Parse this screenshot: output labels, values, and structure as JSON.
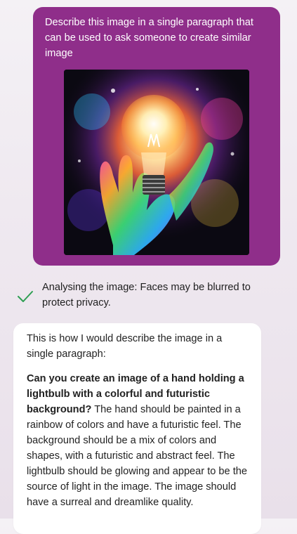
{
  "user_message": {
    "text": "Describe this image in a single paragraph that can be used to ask someone to create similar image",
    "image_alt": "Painted hand holding a glowing lightbulb against a colorful cosmic background",
    "bubble_color": "#8f2e8a"
  },
  "status": {
    "icon": "checkmark-icon",
    "icon_color": "#2e9e52",
    "text": "Analysing the image: Faces may be blurred to protect privacy."
  },
  "bot_message": {
    "intro": "This is how I would describe the image in a single paragraph:",
    "bold_lead": "Can you create an image of a hand holding a lightbulb with a colorful and futuristic background?",
    "body": " The hand should be painted in a rainbow of colors and have a futuristic feel. The background should be a mix of colors and shapes, with a futuristic and abstract feel. The lightbulb should be glowing and appear to be the source of light in the image. The image should have a surreal and dreamlike quality."
  }
}
